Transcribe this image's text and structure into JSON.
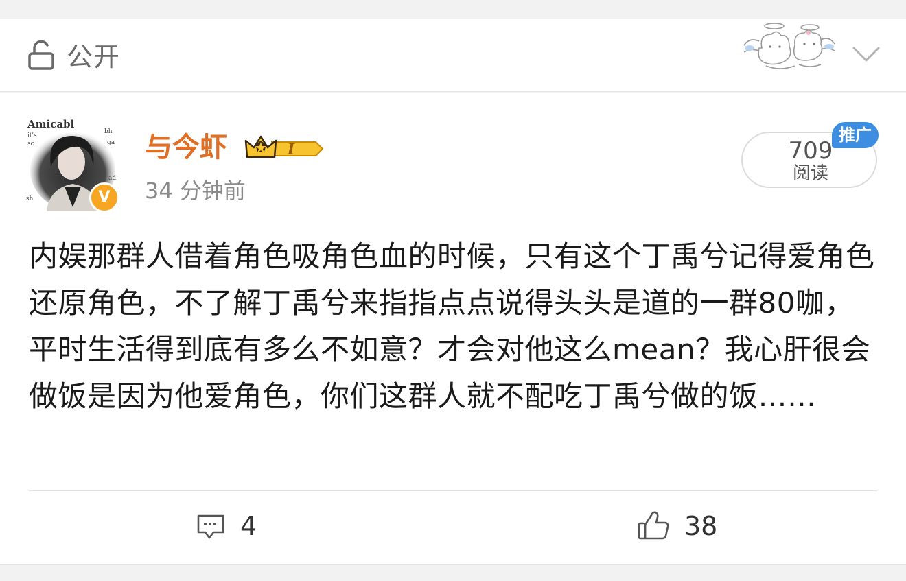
{
  "visibility": {
    "label": "公开"
  },
  "post": {
    "author": {
      "name": "与今虾",
      "member_level": "I",
      "verified_mark": "V"
    },
    "avatar_text": [
      "Amicabl",
      "it's",
      "sc",
      "bh",
      "ga",
      "ad",
      "sh"
    ],
    "timestamp": "34 分钟前",
    "reads": {
      "count": "709",
      "label": "阅读"
    },
    "promo_label": "推广",
    "content": "内娱那群人借着角色吸角色血的时候，只有这个丁禹兮记得爱角色还原角色，不了解丁禹兮来指指点点说得头头是道的一群80咖，平时生活得到底有多么不如意？才会对他这么mean？我心肝很会做饭是因为他爱角色，你们这群人就不配吃丁禹兮做的饭……"
  },
  "actions": {
    "comments": {
      "count": "4",
      "icon": "comment-icon"
    },
    "likes": {
      "count": "38",
      "icon": "thumbs-up-icon"
    }
  },
  "colors": {
    "username": "#e06e25",
    "promo_badge": "#3d8ee0",
    "verified_badge": "#f6a623",
    "text": "#1a1a1a",
    "muted": "#8a8a8a"
  }
}
